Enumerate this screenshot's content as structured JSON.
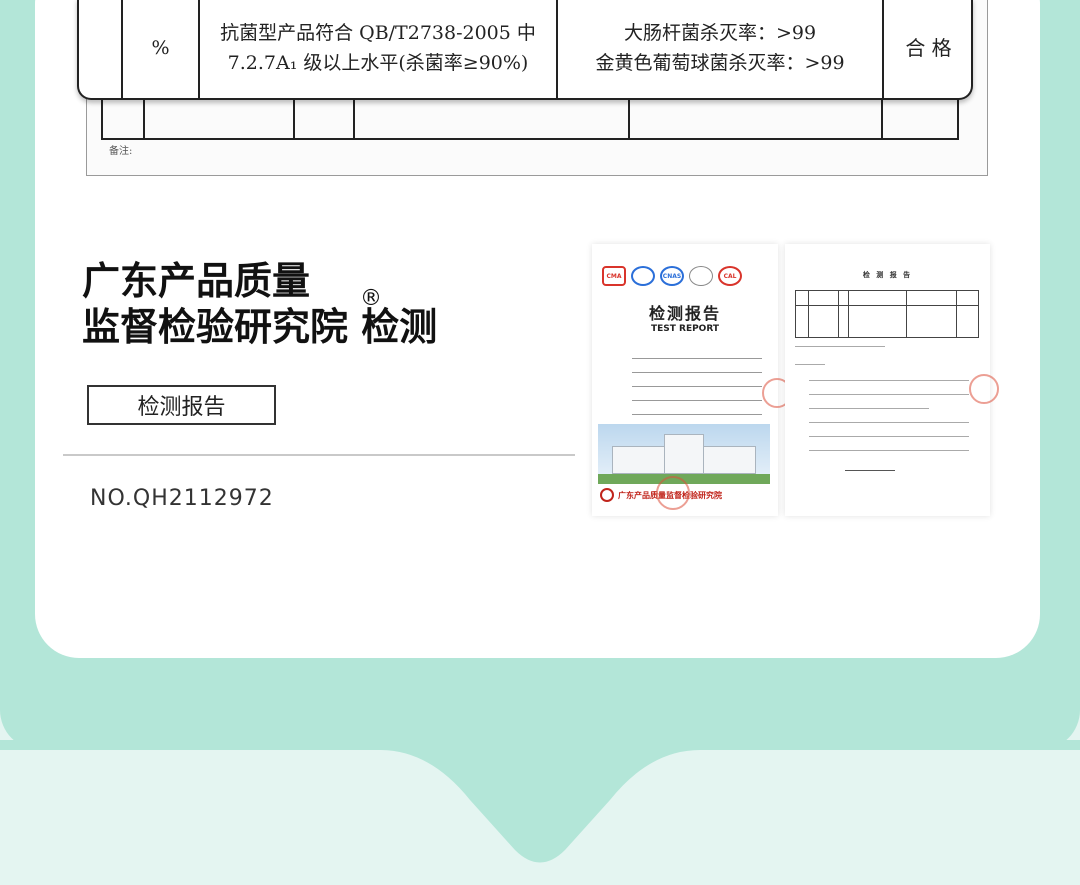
{
  "table_row": {
    "unit": "%",
    "requirement": [
      "抗菌型产品符合 QB/T2738-2005 中",
      "7.2.7A₁ 级以上水平(杀菌率≥90%)"
    ],
    "result": [
      "大肠杆菌杀灭率：>99",
      "金黄色葡萄球菌杀灭率：>99"
    ],
    "verdict": "合 格",
    "note": "备注:"
  },
  "org": {
    "line1": "广东产品质量",
    "line2": "监督检验研究院 检测",
    "registered_mark": "®"
  },
  "tag_label": "检测报告",
  "report_no": "NO.QH2112972",
  "thumb_cover": {
    "badges": [
      "CMA",
      "",
      "CNAS",
      "",
      "CAL"
    ],
    "title": "检测报告",
    "subtitle": "TEST REPORT",
    "footer": "广东产品质量监督检验研究院"
  },
  "thumb_page": {
    "title": "检 测 报 告"
  },
  "colors": {
    "band": "#b3e6d8",
    "background": "#e4f5f1",
    "card": "#ffffff",
    "seal_red": "#c0241b"
  }
}
